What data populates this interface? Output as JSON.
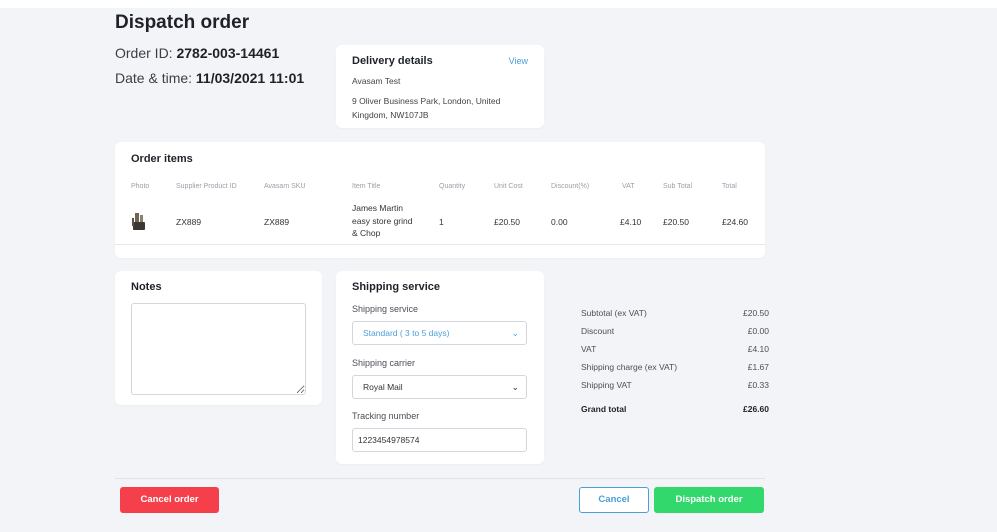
{
  "header": {
    "title": "Dispatch order",
    "order_id_label": "Order ID: ",
    "order_id": "2782-003-14461",
    "datetime_label": "Date & time: ",
    "datetime": "11/03/2021 11:01"
  },
  "delivery": {
    "title": "Delivery details",
    "view_label": "View",
    "name": "Avasam Test",
    "address": "9 Oliver Business Park, London, United Kingdom, NW107JB"
  },
  "order_items": {
    "title": "Order items",
    "columns": [
      "Photo",
      "Supplier Product ID",
      "Avasam SKU",
      "Item Title",
      "Quantity",
      "Unit Cost",
      "Discount(%)",
      "VAT",
      "Sub Total",
      "Total"
    ],
    "rows": [
      {
        "photo_icon": "blender-product-icon",
        "supplier_product_id": "ZX889",
        "sku": "ZX889",
        "title": "James Martin easy store grind & Chop",
        "quantity": "1",
        "unit_cost": "£20.50",
        "discount": "0.00",
        "vat": "£4.10",
        "sub_total": "£20.50",
        "total": "£24.60"
      }
    ]
  },
  "notes": {
    "title": "Notes",
    "value": ""
  },
  "shipping": {
    "title": "Shipping service",
    "service_label": "Shipping service",
    "service_value": "Standard ( 3 to 5 days)",
    "carrier_label": "Shipping carrier",
    "carrier_value": "Royal Mail",
    "tracking_label": "Tracking number",
    "tracking_value": "1223454978574"
  },
  "totals": [
    {
      "label": "Subtotal (ex VAT)",
      "value": "£20.50"
    },
    {
      "label": "Discount",
      "value": "£0.00"
    },
    {
      "label": "VAT",
      "value": "£4.10"
    },
    {
      "label": "Shipping charge (ex VAT)",
      "value": "£1.67"
    },
    {
      "label": "Shipping VAT",
      "value": "£0.33"
    },
    {
      "label": "Grand total",
      "value": "£26.60"
    }
  ],
  "actions": {
    "cancel_order": "Cancel order",
    "cancel": "Cancel",
    "dispatch": "Dispatch order"
  },
  "colors": {
    "accent_blue": "#4a9fd9",
    "danger_red": "#f5404b",
    "success_green": "#32d86b",
    "background": "#f3f4f7"
  }
}
